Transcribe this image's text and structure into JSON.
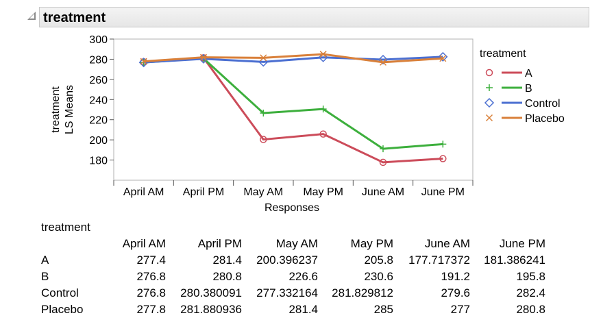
{
  "outline": {
    "title": "treatment"
  },
  "chart_data": {
    "type": "line",
    "categories": [
      "April AM",
      "April PM",
      "May AM",
      "May PM",
      "June AM",
      "June PM"
    ],
    "xlabel": "Responses",
    "ylabel": [
      "treatment",
      "LS Means"
    ],
    "ylim": [
      160,
      300
    ],
    "yticks": [
      180,
      200,
      220,
      240,
      260,
      280,
      300
    ],
    "grid": false,
    "legend": {
      "title": "treatment",
      "position": "right"
    },
    "series": [
      {
        "name": "A",
        "color": "#cc4c5a",
        "marker": "circle",
        "values": [
          277.4,
          281.4,
          200.396237,
          205.8,
          177.717372,
          181.386241
        ]
      },
      {
        "name": "B",
        "color": "#3daf3d",
        "marker": "plus",
        "values": [
          276.8,
          280.8,
          226.6,
          230.6,
          191.2,
          195.8
        ]
      },
      {
        "name": "Control",
        "color": "#4b6fd1",
        "marker": "diamond",
        "values": [
          276.8,
          280.380091,
          277.332164,
          281.829812,
          279.6,
          282.4
        ]
      },
      {
        "name": "Placebo",
        "color": "#d9803a",
        "marker": "x",
        "values": [
          277.8,
          281.880936,
          281.4,
          285,
          277,
          280.8
        ]
      }
    ]
  },
  "table": {
    "title": "treatment",
    "columns": [
      "April AM",
      "April PM",
      "May AM",
      "May PM",
      "June AM",
      "June PM"
    ],
    "rows": [
      {
        "label": "A",
        "cells": [
          "277.4",
          "281.4",
          "200.396237",
          "205.8",
          "177.717372",
          "181.386241"
        ]
      },
      {
        "label": "B",
        "cells": [
          "276.8",
          "280.8",
          "226.6",
          "230.6",
          "191.2",
          "195.8"
        ]
      },
      {
        "label": "Control",
        "cells": [
          "276.8",
          "280.380091",
          "277.332164",
          "281.829812",
          "279.6",
          "282.4"
        ]
      },
      {
        "label": "Placebo",
        "cells": [
          "277.8",
          "281.880936",
          "281.4",
          "285",
          "277",
          "280.8"
        ]
      }
    ]
  }
}
